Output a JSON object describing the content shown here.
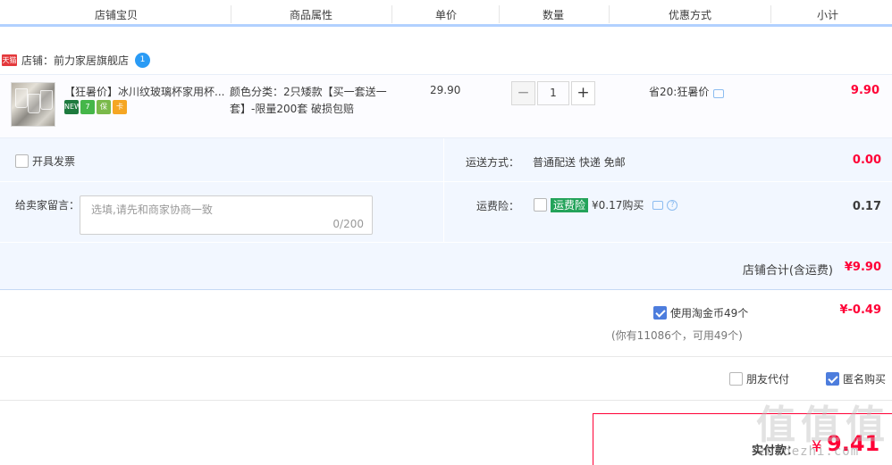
{
  "header": {
    "columns": [
      "店铺宝贝",
      "商品属性",
      "单价",
      "数量",
      "优惠方式",
      "小计"
    ]
  },
  "shop": {
    "tag": "天猫",
    "label": "店铺：前力家居旗舰店",
    "wangwang_badge": "1"
  },
  "item": {
    "title": "【狂暑价】冰川纹玻璃杯家用杯...",
    "badges": [
      {
        "icon": "new-badge-icon",
        "text": "NEW",
        "color": "#1d7a3e"
      },
      {
        "icon": "seven-day-return-icon",
        "text": "7",
        "color": "#45b649"
      },
      {
        "icon": "guarantee-icon",
        "text": "保",
        "color": "#7ab94a"
      },
      {
        "icon": "credit-card-icon",
        "text": "卡",
        "color": "#f5a623"
      }
    ],
    "attributes": "颜色分类：2只矮款【买一套送一套】-限量200套 破损包赔",
    "unit_price": "29.90",
    "quantity": "1",
    "qty_minus": "−",
    "qty_plus": "+",
    "discount": "省20:狂暑价",
    "subtotal": "9.90"
  },
  "order": {
    "invoice_label": "开具发票",
    "shipping_label": "运送方式：",
    "shipping_value": "普通配送 快递 免邮",
    "shipping_fee": "0.00",
    "memo_label": "给卖家留言：",
    "memo_placeholder": "选填,请先和商家协商一致",
    "memo_count": "0/200",
    "insurance_label": "运费险：",
    "insurance_tag": "运费险",
    "insurance_text": "¥0.17购买",
    "insurance_fee": "0.17",
    "shop_total_label": "店铺合计(含运费)",
    "shop_total_value": "¥9.90"
  },
  "coins": {
    "label": "使用淘金币49个",
    "amount": "¥-0.49",
    "note": "(你有11086个，可用49个)"
  },
  "options": {
    "friend_pay": "朋友代付",
    "anonymous": "匿名购买"
  },
  "payment": {
    "label": "实付款：",
    "currency": "¥",
    "value": "9.41"
  },
  "watermark": {
    "glyphs": [
      "值",
      "值",
      "值"
    ],
    "site": "zhidezhi.com"
  },
  "colors": {
    "accent_red": "#ff0036",
    "header_line": "#b2d1ff",
    "block_bg": "#f2f7ff",
    "check_blue": "#4d7ddd"
  }
}
